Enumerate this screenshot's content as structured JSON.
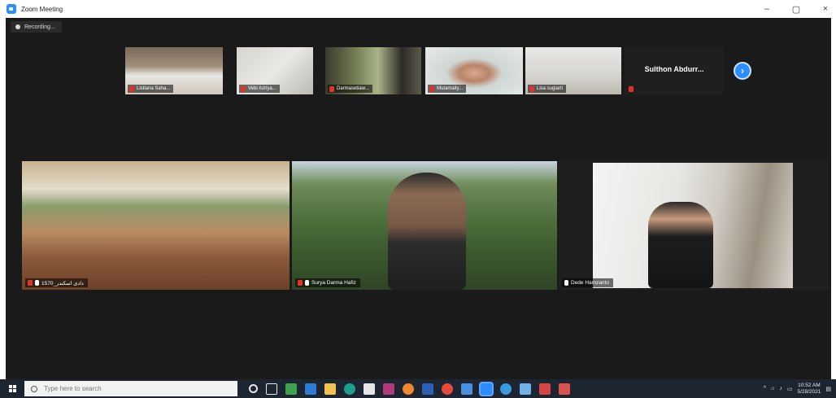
{
  "window": {
    "title": "Zoom Meeting"
  },
  "recording": {
    "label": "Recording..."
  },
  "thumbnails": [
    {
      "name": "Listiana Saha..."
    },
    {
      "name": "Vebi Azriya..."
    },
    {
      "name": "Darmasetiaw..."
    },
    {
      "name": "Mutamaity..."
    },
    {
      "name": "Lisa sugiarti"
    },
    {
      "name": ""
    }
  ],
  "name_only_tile": {
    "name": "Sulthon Abdurr..."
  },
  "gallery": [
    {
      "name": "1570_دادی اسکندر"
    },
    {
      "name": "Surya Darma Hafiz"
    },
    {
      "name": "Dede Hamzanto"
    }
  ],
  "taskbar": {
    "search_placeholder": "Type here to search",
    "clock_time": "10:52 AM",
    "clock_date": "5/28/2021"
  },
  "colors": {
    "accent": "#2d8cff",
    "active_speaker": "#c9de3b",
    "muted": "#e0342a"
  }
}
